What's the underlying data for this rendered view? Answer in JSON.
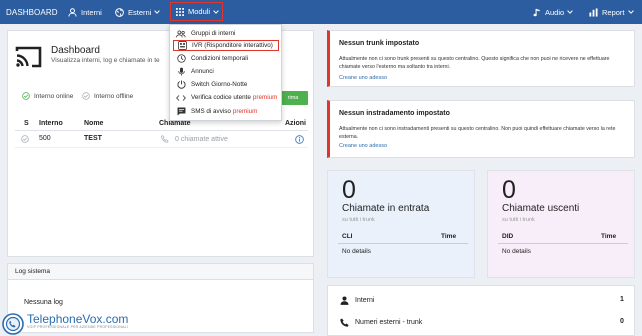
{
  "topbar": {
    "brand": "DASHBOARD",
    "nav": {
      "interni": "Interni",
      "esterni": "Esterni",
      "moduli": "Moduli",
      "audio": "Audio",
      "report": "Report"
    },
    "accent_color": "#2b5da0"
  },
  "moduli_menu": [
    {
      "icon": "group-icon",
      "label": "Gruppi di interni",
      "premium": ""
    },
    {
      "icon": "ivr-icon",
      "label": "IVR (Risponditore interattivo)",
      "premium": ""
    },
    {
      "icon": "clock-icon",
      "label": "Condizioni temporali",
      "premium": ""
    },
    {
      "icon": "microphone-icon",
      "label": "Annunci",
      "premium": ""
    },
    {
      "icon": "switch-icon",
      "label": "Switch Giorno-Notte",
      "premium": ""
    },
    {
      "icon": "code-icon",
      "label": "Verifica codice utente",
      "premium": "premium"
    },
    {
      "icon": "sms-icon",
      "label": "SMS di avviso",
      "premium": "premium"
    }
  ],
  "dashboard": {
    "title": "Dashboard",
    "subtitle": "Visualizza interni, log e chiamate in te",
    "legend_online": "Interno online",
    "legend_offline": "Interno offline",
    "green_button": "rima",
    "headers": {
      "s": "S",
      "interno": "Interno",
      "nome": "Nome",
      "chiamate": "Chiamate",
      "azioni": "Azioni"
    },
    "rows": [
      {
        "interno": "500",
        "nome": "TEST",
        "chiamate": "0 chiamate attive"
      }
    ]
  },
  "log": {
    "title": "Log sistema",
    "empty": "Nessuna log"
  },
  "alerts": [
    {
      "title": "Nessun trunk impostato",
      "text": "Attualmente non ci sono trunk presenti su questo centralino. Questo significa che non puoi ne ricevere ne effettuare chiamate verso l'esterno ma soltanto tra interni.",
      "link": "Creane uno adesso"
    },
    {
      "title": "Nessun instradamento impostato",
      "text": "Attualmente non ci sono instradamenti presenti su questo centralino. Non puoi quindi effettuare chiamate verso la rete esterna.",
      "link": "Creane uno adesso"
    }
  ],
  "calls_in": {
    "count": "0",
    "label": "Chiamate in entrata",
    "sub": "su tutti i trunk",
    "col1": "CLI",
    "col2": "Time",
    "empty": "No details"
  },
  "calls_out": {
    "count": "0",
    "label": "Chiamate uscenti",
    "sub": "su tutti i trunk",
    "col1": "DID",
    "col2": "Time",
    "empty": "No details"
  },
  "summary": [
    {
      "icon": "user-icon",
      "label": "Interni",
      "value": "1"
    },
    {
      "icon": "phone-icon",
      "label": "Numeri esterni - trunk",
      "value": "0"
    }
  ],
  "watermark": {
    "title": "TelephoneVox.com",
    "tagline": "VOIP PROFESSIONALE PER AZIENDE PROFESSIONALI"
  }
}
